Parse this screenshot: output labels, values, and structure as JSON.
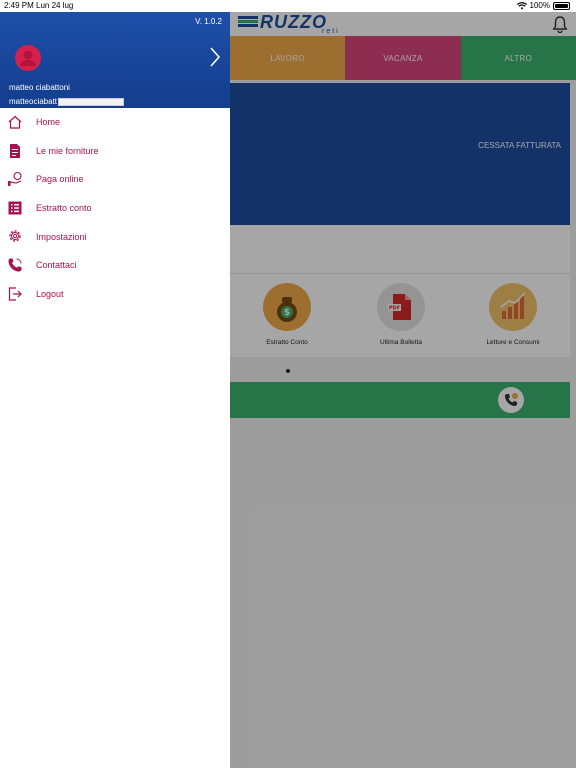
{
  "status_bar": {
    "time": "2:49 PM",
    "date": "Lun 24 lug",
    "battery": "100%"
  },
  "app": {
    "logo": {
      "text": "RUZZO",
      "sub": "reti"
    },
    "tabs": [
      {
        "label": "LAVORO",
        "color": "#f0a94a"
      },
      {
        "label": "VACANZA",
        "color": "#d9487d"
      },
      {
        "label": "ALTRO",
        "color": "#3cb371"
      }
    ],
    "supply_status": "CESSATA FATTURATA",
    "quick_actions": [
      {
        "label": "Estratto Conto",
        "icon": "money-bag-icon"
      },
      {
        "label": "Ultima Bolletta",
        "icon": "pdf-icon"
      },
      {
        "label": "Letture e Consumi",
        "icon": "bar-chart-icon"
      }
    ]
  },
  "drawer": {
    "version": "V. 1.0.2",
    "user": {
      "name": "matteo ciabattoni",
      "email": "matteociabatt"
    },
    "menu": [
      {
        "label": "Home",
        "icon": "home-icon"
      },
      {
        "label": "Le mie forniture",
        "icon": "document-icon"
      },
      {
        "label": "Paga online",
        "icon": "pay-online-icon"
      },
      {
        "label": "Estratto conto",
        "icon": "list-icon"
      },
      {
        "label": "Impostazioni",
        "icon": "gear-icon"
      },
      {
        "label": "Contattaci",
        "icon": "phone-icon"
      },
      {
        "label": "Logout",
        "icon": "logout-icon"
      }
    ]
  },
  "colors": {
    "primary_blue": "#1d4ea0",
    "accent_magenta": "#a8124f",
    "green": "#3cb371"
  }
}
